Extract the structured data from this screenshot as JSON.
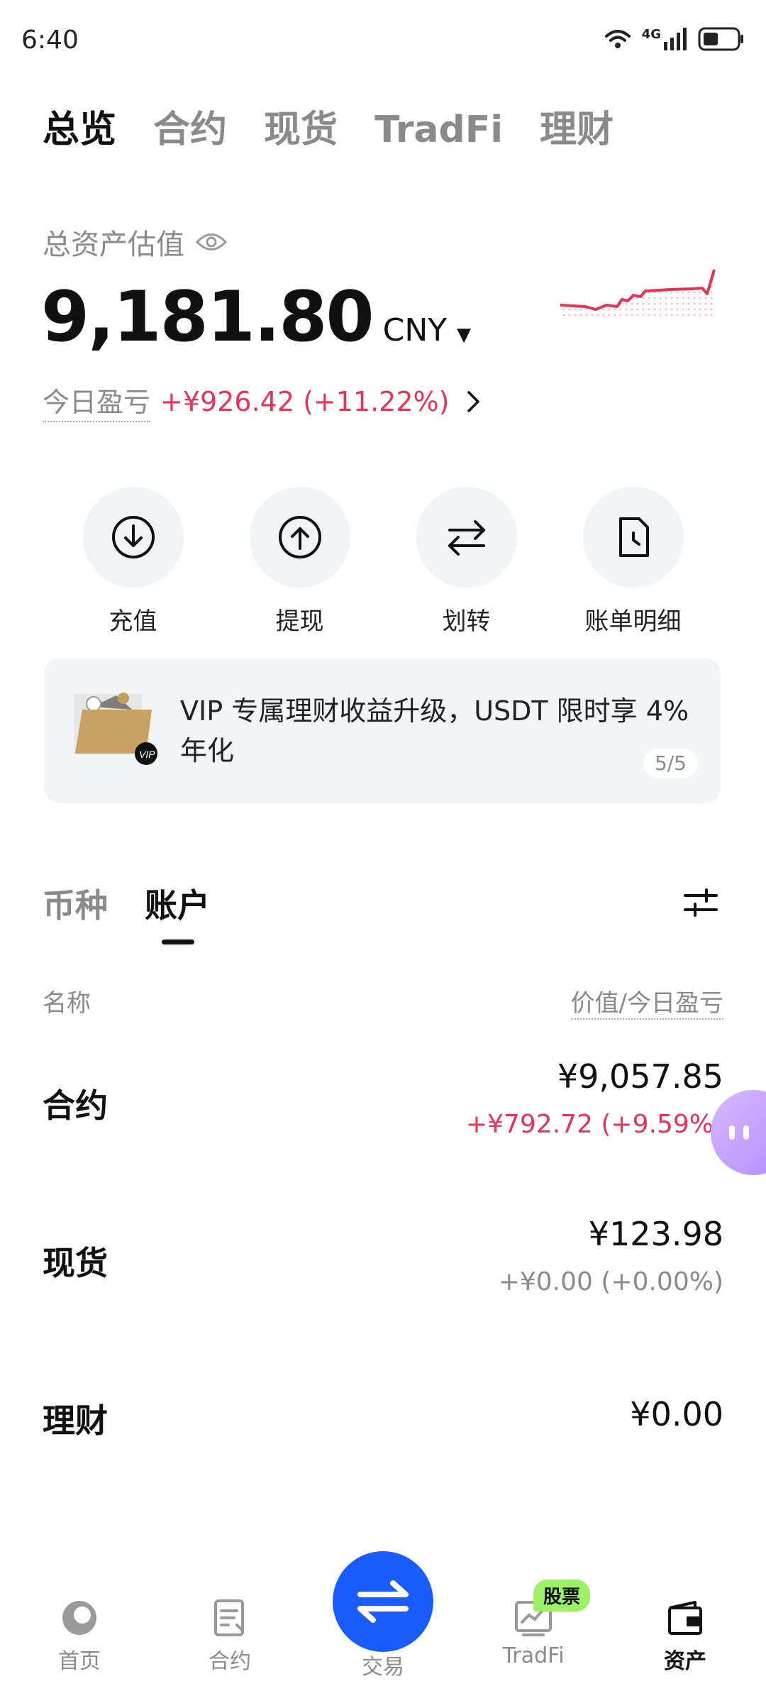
{
  "status_bar": {
    "time": "6:40",
    "network": "4G"
  },
  "top_tabs": [
    {
      "label": "总览",
      "active": true
    },
    {
      "label": "合约",
      "active": false
    },
    {
      "label": "现货",
      "active": false
    },
    {
      "label": "TradFi",
      "active": false
    },
    {
      "label": "理财",
      "active": false
    }
  ],
  "summary": {
    "label": "总资产估值",
    "value": "9,181.80",
    "currency": "CNY",
    "pnl_label": "今日盈亏",
    "pnl_value": "+¥926.42 (+11.22%)"
  },
  "actions": [
    {
      "label": "充值",
      "icon": "deposit-icon"
    },
    {
      "label": "提现",
      "icon": "withdraw-icon"
    },
    {
      "label": "划转",
      "icon": "transfer-icon"
    },
    {
      "label": "账单明细",
      "icon": "bill-icon"
    }
  ],
  "banner": {
    "text": "VIP 专属理财收益升级，USDT 限时享 4% 年化",
    "page": "5/5"
  },
  "section_tabs": [
    {
      "label": "币种",
      "active": false
    },
    {
      "label": "账户",
      "active": true
    }
  ],
  "list": {
    "col_name": "名称",
    "col_value": "价值/今日盈亏",
    "rows": [
      {
        "name": "合约",
        "value": "¥9,057.85",
        "pnl": "+¥792.72 (+9.59%)",
        "pnl_color": "#e6335a"
      },
      {
        "name": "现货",
        "value": "¥123.98",
        "pnl": "+¥0.00 (+0.00%)",
        "pnl_color": "#8a8a8a"
      },
      {
        "name": "理财",
        "value": "¥0.00"
      }
    ]
  },
  "bottom_nav": {
    "items": [
      {
        "label": "首页",
        "icon": "home-icon"
      },
      {
        "label": "合约",
        "icon": "contract-icon"
      },
      {
        "label": "交易",
        "icon": "trade-icon"
      },
      {
        "label": "TradFi",
        "icon": "tradfi-icon",
        "badge": "股票"
      },
      {
        "label": "资产",
        "icon": "wallet-icon",
        "active": true
      }
    ]
  },
  "colors": {
    "accent": "#1a5cff",
    "positive": "#e6335a",
    "badge": "#9bf068"
  }
}
